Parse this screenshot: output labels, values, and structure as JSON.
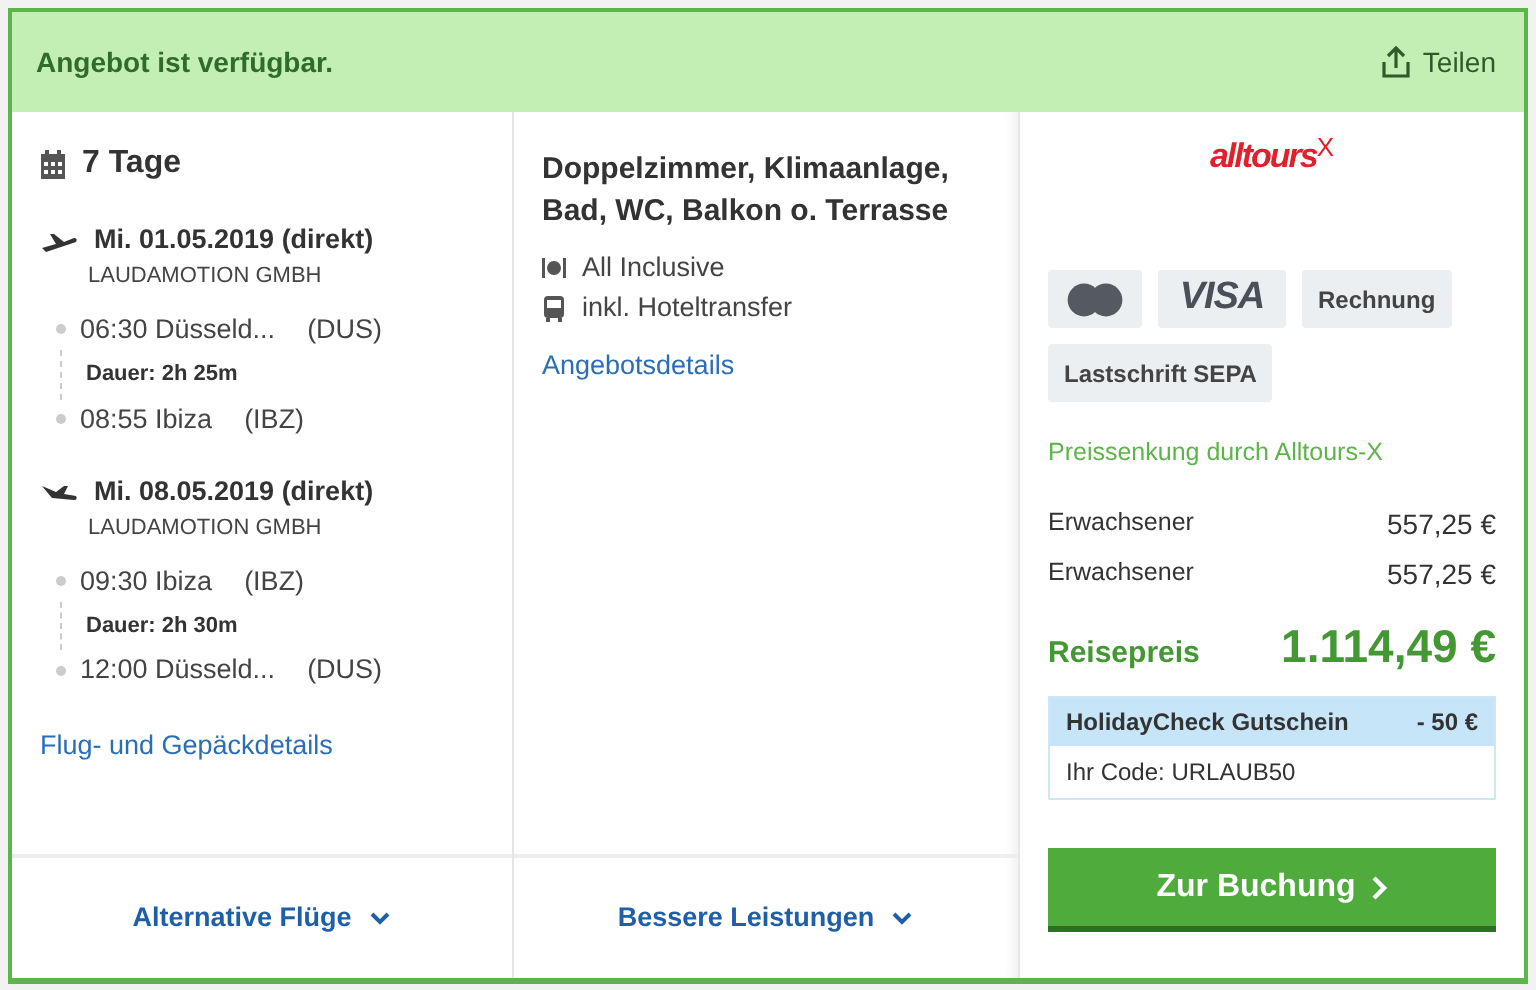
{
  "header": {
    "status": "Angebot ist verfügbar.",
    "share": "Teilen"
  },
  "trip": {
    "duration": "7 Tage",
    "flights": [
      {
        "kind": "outbound",
        "date": "Mi. 01.05.2019 (direkt)",
        "airline": "LAUDAMOTION GMBH",
        "departure": {
          "time": "06:30",
          "place": "Düsseld...",
          "code": "(DUS)"
        },
        "flight_time": "Dauer: 2h 25m",
        "arrival": {
          "time": "08:55",
          "place": "Ibiza",
          "code": "(IBZ)"
        }
      },
      {
        "kind": "return",
        "date": "Mi. 08.05.2019 (direkt)",
        "airline": "LAUDAMOTION GMBH",
        "departure": {
          "time": "09:30",
          "place": "Ibiza",
          "code": "(IBZ)"
        },
        "flight_time": "Dauer: 2h 30m",
        "arrival": {
          "time": "12:00",
          "place": "Düsseld...",
          "code": "(DUS)"
        }
      }
    ],
    "details_link": "Flug- und Gepäckdetails",
    "footer_button": "Alternative Flüge"
  },
  "room": {
    "title": "Doppelzimmer, Klimaanlage, Bad, WC, Balkon o. Terrasse",
    "features": [
      {
        "kind": "board",
        "text": "All Inclusive"
      },
      {
        "kind": "transfer",
        "text": "inkl. Hoteltransfer"
      }
    ],
    "details_link": "Angebotsdetails",
    "footer_button": "Bessere Leistungen"
  },
  "booking": {
    "operator_logo": {
      "name": "alltours",
      "suffix": "X"
    },
    "payment_methods": [
      {
        "kind": "mastercard"
      },
      {
        "kind": "visa",
        "text": "VISA"
      },
      {
        "kind": "text",
        "text": "Rechnung"
      },
      {
        "kind": "text",
        "text": "Lastschrift SEPA"
      }
    ],
    "price_note": "Preissenkung durch Alltours-X",
    "travellers": [
      {
        "label": "Erwachsener",
        "price": "557,25 €"
      },
      {
        "label": "Erwachsener",
        "price": "557,25 €"
      }
    ],
    "total": {
      "label": "Reisepreis",
      "price": "1.114,49 €"
    },
    "voucher": {
      "title": "HolidayCheck Gutschein",
      "discount": "- 50 €",
      "code": "Ihr Code: URLAUB50"
    },
    "book_button": "Zur Buchung"
  }
}
